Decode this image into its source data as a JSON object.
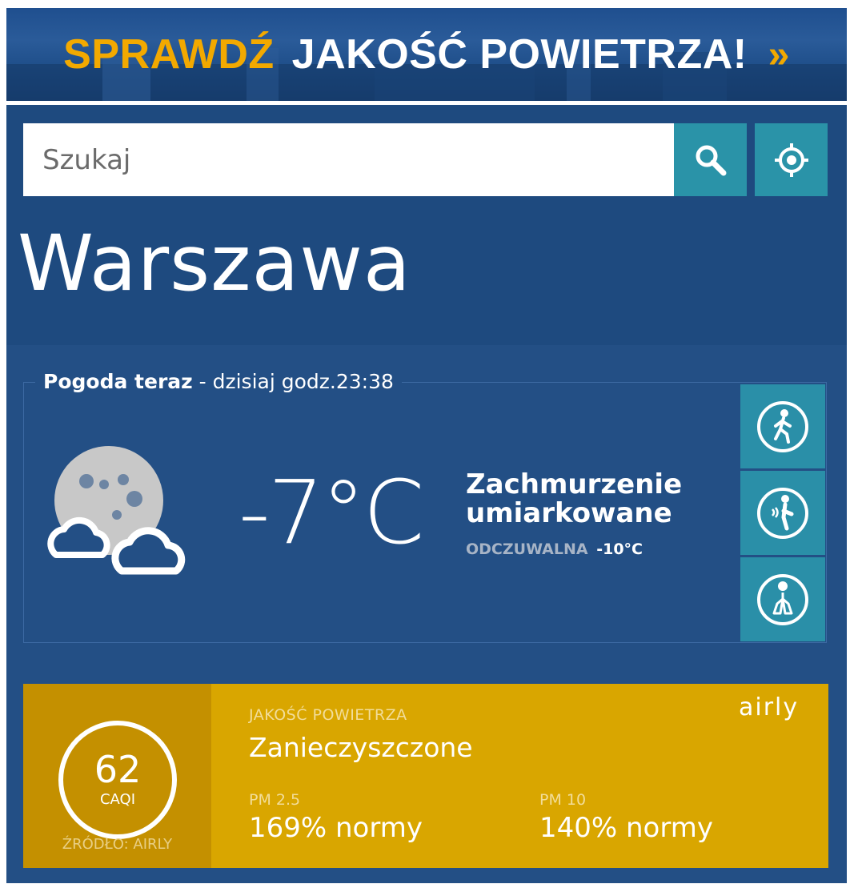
{
  "banner": {
    "word1": "SPRAWDŹ",
    "word2": "JAKOŚĆ POWIETRZA!",
    "arrow": "»"
  },
  "search": {
    "placeholder": "Szukaj",
    "search_icon": "search-icon",
    "locate_icon": "locate-icon"
  },
  "city": "Warszawa",
  "weather": {
    "label_bold": "Pogoda teraz",
    "label_rest": " - dzisiaj  godz.23:38",
    "icon": "moon-clouds-icon",
    "temperature": "-7°C",
    "condition_line1": "Zachmurzenie",
    "condition_line2": "umiarkowane",
    "feels_label": "ODCZUWALNA",
    "feels_value": "-10°C",
    "side_icons": [
      "walking-person-icon",
      "joint-pain-icon",
      "lungs-icon"
    ]
  },
  "air_quality": {
    "index": "62",
    "unit": "CAQI",
    "source": "ŹRÓDŁO: AIRLY",
    "label": "JAKOŚĆ POWIETRZA",
    "status": "Zanieczyszczone",
    "pm25_label": "PM 2.5",
    "pm25_value": "169% normy",
    "pm10_label": "PM 10",
    "pm10_value": "140% normy",
    "logo": "airly",
    "color_bg": "#d9a600",
    "color_left": "#c49000"
  },
  "colors": {
    "panel": "#234f85",
    "accent_teal": "#2a93a8",
    "banner_yellow": "#f2a900"
  }
}
